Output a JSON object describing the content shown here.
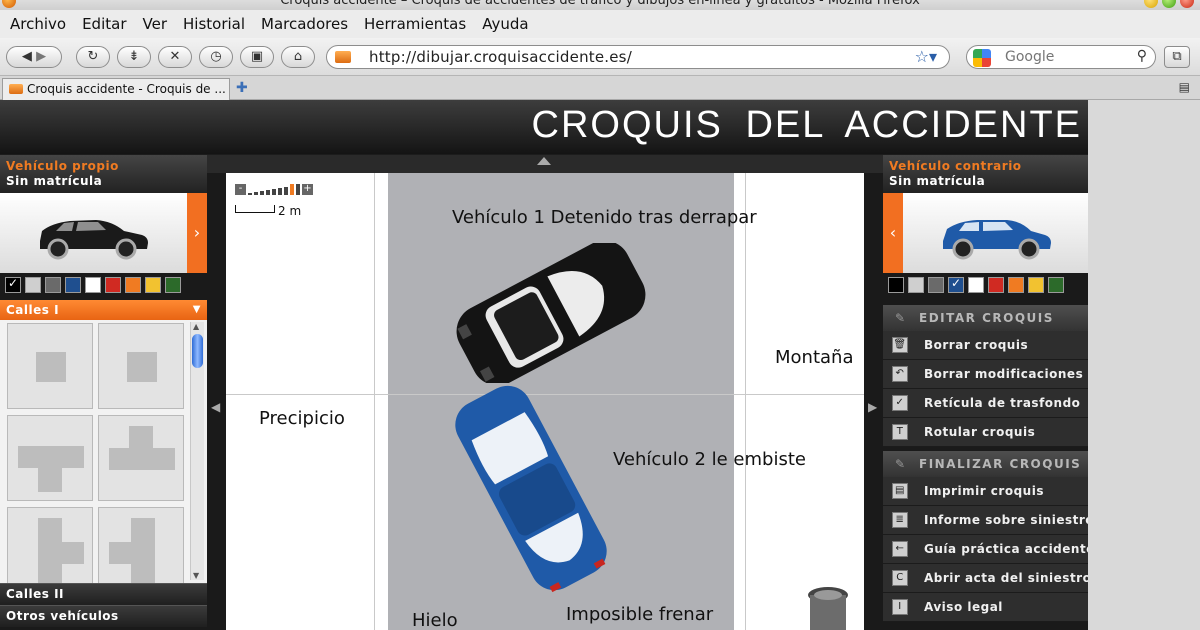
{
  "browser": {
    "window_title": "Croquis accidente – Croquis de accidentes de tráfico y dibujos en-línea y gratuitos - Mozilla Firefox",
    "menu": [
      "Archivo",
      "Editar",
      "Ver",
      "Historial",
      "Marcadores",
      "Herramientas",
      "Ayuda"
    ],
    "url": "http://dibujar.croquisaccidente.es/",
    "search_placeholder": "Google",
    "tab_title": "Croquis accidente - Croquis de ...",
    "icons": [
      "back-icon",
      "forward-icon",
      "reload-icon",
      "stop-icon",
      "history-icon",
      "home-icon",
      "bookmark-star-icon",
      "search-icon",
      "new-tab-icon"
    ]
  },
  "app": {
    "title": "CROQUIS DEL ACCIDENTE",
    "left": {
      "vehicle_label": "Vehículo propio",
      "plate": "Sin matrícula",
      "car_color": "#1a1a1a",
      "swatches": [
        "#000000",
        "#cfcfcf",
        "#6a6a6a",
        "#1f4f8f",
        "#ffffff",
        "#d02a22",
        "#f07b22",
        "#f2c230",
        "#2c6a2a"
      ],
      "selected_swatch": 0,
      "category_open": "Calles I",
      "sections": [
        "Calles II",
        "Otros vehículos"
      ]
    },
    "right": {
      "vehicle_label": "Vehículo contrario",
      "plate": "Sin matrícula",
      "car_color": "#1f5aa8",
      "swatches": [
        "#000000",
        "#cfcfcf",
        "#6a6a6a",
        "#1f4f8f",
        "#ffffff",
        "#d02a22",
        "#f07b22",
        "#f2c230",
        "#2c6a2a"
      ],
      "selected_swatch": 3,
      "edit_header": "EDITAR CROQUIS",
      "edit_items": [
        "Borrar croquis",
        "Borrar modificaciones",
        "Retícula de trasfondo",
        "Rotular croquis"
      ],
      "finish_header": "FINALIZAR CROQUIS",
      "finish_items": [
        "Imprimir croquis",
        "Informe sobre siniestro",
        "Guía práctica accidente",
        "Abrir acta del siniestro",
        "Aviso legal"
      ]
    },
    "canvas": {
      "scale": "2 m",
      "labels": {
        "v1": "Vehículo 1 Detenido tras derrapar",
        "mountain": "Montaña",
        "precipice": "Precipicio",
        "v2": "Vehículo 2 le embiste",
        "ice": "Hielo",
        "nobrake": "Imposible frenar"
      }
    }
  }
}
